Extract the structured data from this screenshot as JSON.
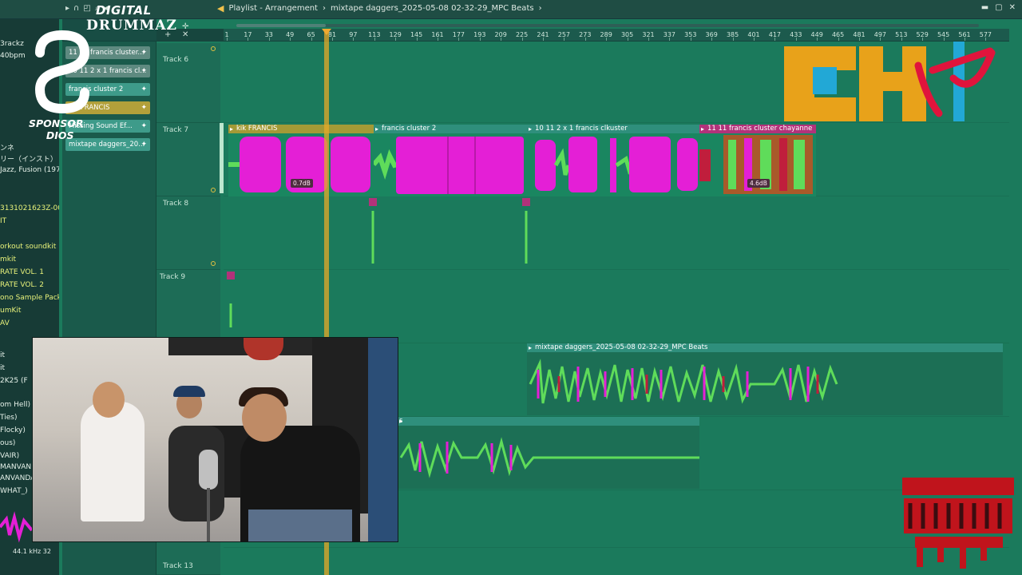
{
  "window": {
    "title_prefix": "Playlist - Arrangement",
    "separator": "›",
    "project_name": "mixtape daggers_2025-05-08 02-32-29_MPC Beats"
  },
  "brand": {
    "digital": "DIGITAL",
    "drummaz": "DRUMMAZ",
    "sponsor_line1": "SPONSOR",
    "sponsor_line2": "DIOS"
  },
  "browser": {
    "items": [
      {
        "text": "3rackz",
        "hl": false
      },
      {
        "text": "40bpm",
        "hl": false
      },
      {
        "text": "ンネ",
        "hl": false
      },
      {
        "text": "リー（インスト）",
        "hl": false
      },
      {
        "text": "Jazz, Fusion (1976)",
        "hl": false
      },
      {
        "text": "3131021623Z-001",
        "hl": true
      },
      {
        "text": "IT",
        "hl": true
      },
      {
        "text": "orkout soundkit",
        "hl": true
      },
      {
        "text": "mkit",
        "hl": true
      },
      {
        "text": "RATE VOL. 1",
        "hl": true
      },
      {
        "text": "RATE VOL. 2",
        "hl": true
      },
      {
        "text": "ono Sample Pack",
        "hl": true
      },
      {
        "text": "umKit",
        "hl": true
      },
      {
        "text": "AV",
        "hl": true
      },
      {
        "text": "it",
        "hl": false
      },
      {
        "text": "it",
        "hl": false
      },
      {
        "text": "2K25 (F",
        "hl": false
      },
      {
        "text": "om Hell)",
        "hl": false
      },
      {
        "text": "Ties)",
        "hl": false
      },
      {
        "text": "Flocky)",
        "hl": false
      },
      {
        "text": "ous)",
        "hl": false
      },
      {
        "text": "VAIR)",
        "hl": false
      },
      {
        "text": "MANVANDA",
        "hl": false
      },
      {
        "text": "ANVANDA",
        "hl": false
      },
      {
        "text": "WHAT_)",
        "hl": false
      }
    ],
    "sample_rate": "44.1 kHz 32"
  },
  "picker": {
    "clips": [
      {
        "label": "11 11 francis cluster...",
        "color": "#5e8a80"
      },
      {
        "label": "10 11 2 x 1 francis cl...",
        "color": "#5e8a80"
      },
      {
        "label": "francis cluster 2",
        "color": "#3e9b8a"
      },
      {
        "label": "kik FRANCIS",
        "color": "#b2a03a"
      },
      {
        "label": "Missing Sound Ef...",
        "color": "#3e9b8a"
      },
      {
        "label": "mixtape daggers_20...",
        "color": "#3e9b8a"
      }
    ]
  },
  "ruler": {
    "ticks": [
      "1",
      "17",
      "33",
      "49",
      "65",
      "81",
      "97",
      "113",
      "129",
      "145",
      "161",
      "177",
      "193",
      "209",
      "225",
      "241",
      "257",
      "273",
      "289",
      "305",
      "321",
      "337",
      "353",
      "369",
      "385",
      "401",
      "417",
      "433",
      "449",
      "465",
      "481",
      "497",
      "513",
      "529",
      "545",
      "561",
      "577"
    ]
  },
  "tracks": [
    {
      "name": "Track 6"
    },
    {
      "name": "Track 7"
    },
    {
      "name": "Track 8"
    },
    {
      "name": "Track 9"
    },
    {
      "name": "Track 13"
    }
  ],
  "arrangement_clips": {
    "kik": "kik FRANCIS",
    "cluster2": "francis cluster 2",
    "clkuster": "10 11 2 x 1 francis clkuster",
    "chayanne": "11 11 francis cluster chayanne",
    "mixtape": "mixtape daggers_2025-05-08 02-32-29_MPC Beats",
    "partial": "s",
    "gain1": "0.7dB",
    "gain2": "4.6dB"
  },
  "logos": {
    "chtv": "CHTV",
    "parental": "PARENTAL"
  },
  "colors": {
    "magenta_clip": "#e41fd6",
    "green_clip": "#1fae53",
    "playlist_bg": "#1b7a5c",
    "playhead": "#f0a930"
  }
}
